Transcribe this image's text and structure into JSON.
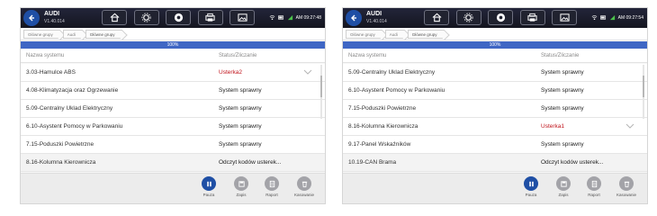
{
  "screens": [
    {
      "brand": "AUDI",
      "version": "V1.40.014",
      "clock": "AM 09:27:48",
      "breadcrumb": [
        "Główne grupy",
        "Audi",
        "Główne grupy"
      ],
      "progress": {
        "value": 1.0,
        "label": "100%"
      },
      "columns": {
        "name": "Nazwa systemu",
        "status": "Status/Zliczanie"
      },
      "rows": [
        {
          "name": "3.03-Hamulce ABS",
          "status": "Usterka2",
          "error": true,
          "expand": true
        },
        {
          "name": "4.08-Klimatyzacja oraz Ogrzewanie",
          "status": "System sprawny",
          "error": false,
          "expand": false
        },
        {
          "name": "5.09-Centralny Uklad Elektryczny",
          "status": "System sprawny",
          "error": false,
          "expand": false
        },
        {
          "name": "6.10-Asystent Pomocy w Parkowaniu",
          "status": "System sprawny",
          "error": false,
          "expand": false
        },
        {
          "name": "7.15-Poduszki Powietrzne",
          "status": "System sprawny",
          "error": false,
          "expand": false
        },
        {
          "name": "8.16-Kolumna Kierownicza",
          "status": "Odczyt kodów usterek...",
          "error": false,
          "expand": false
        }
      ],
      "actions": {
        "pause": "Pauza",
        "save": "Zapis",
        "report": "Raport",
        "delete": "Kasowanie"
      }
    },
    {
      "brand": "AUDI",
      "version": "V1.40.014",
      "clock": "AM 09:27:54",
      "breadcrumb": [
        "Główne grupy",
        "Audi",
        "Główne grupy"
      ],
      "progress": {
        "value": 1.0,
        "label": "100%"
      },
      "columns": {
        "name": "Nazwa systemu",
        "status": "Status/Zliczanie"
      },
      "rows": [
        {
          "name": "5.09-Centralny Uklad Elektryczny",
          "status": "System sprawny",
          "error": false,
          "expand": false
        },
        {
          "name": "6.10-Asystent Pomocy w Parkowaniu",
          "status": "System sprawny",
          "error": false,
          "expand": false
        },
        {
          "name": "7.15-Poduszki Powietrzne",
          "status": "System sprawny",
          "error": false,
          "expand": false
        },
        {
          "name": "8.16-Kolumna Kierownicza",
          "status": "Usterka1",
          "error": true,
          "expand": true
        },
        {
          "name": "9.17-Panel Wskaźników",
          "status": "System sprawny",
          "error": false,
          "expand": false
        },
        {
          "name": "10.19-CAN Brama",
          "status": "Odczyt kodów usterek...",
          "error": false,
          "expand": false
        }
      ],
      "actions": {
        "pause": "Pauza",
        "save": "Zapis",
        "report": "Raport",
        "delete": "Kasowanie"
      }
    }
  ],
  "icons": {
    "back": "back-arrow-icon",
    "nav": [
      "home-icon",
      "settings-gear-icon",
      "record-icon",
      "printer-icon",
      "image-gallery-icon"
    ],
    "status": [
      "wifi-icon",
      "battery-icon",
      "signal-icon"
    ],
    "actions": [
      "pause-icon",
      "save-icon",
      "report-icon",
      "delete-icon"
    ]
  },
  "colors": {
    "accent": "#1f4fa5",
    "error": "#c0141c",
    "progress": "#3f66c4",
    "topbar": "#1a1b28"
  }
}
